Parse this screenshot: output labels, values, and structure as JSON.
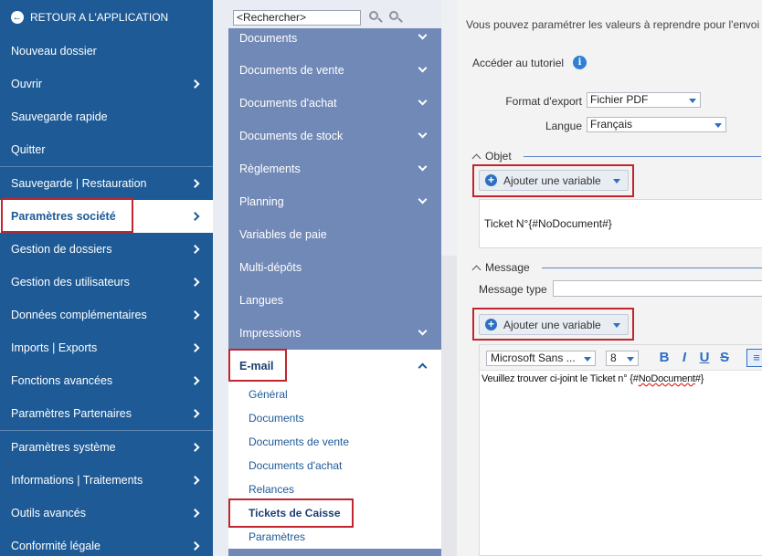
{
  "left_menu": {
    "back_label": "RETOUR A L'APPLICATION",
    "items": [
      {
        "label": "Nouveau dossier"
      },
      {
        "label": "Ouvrir"
      },
      {
        "label": "Sauvegarde rapide"
      },
      {
        "label": "Quitter"
      },
      {
        "label": "Sauvegarde | Restauration"
      },
      {
        "label": "Paramètres société"
      },
      {
        "label": "Gestion de dossiers"
      },
      {
        "label": "Gestion des utilisateurs"
      },
      {
        "label": "Données complémentaires"
      },
      {
        "label": "Imports | Exports"
      },
      {
        "label": "Fonctions avancées"
      },
      {
        "label": "Paramètres Partenaires"
      },
      {
        "label": "Paramètres système"
      },
      {
        "label": "Informations | Traitements"
      },
      {
        "label": "Outils avancés"
      },
      {
        "label": "Conformité légale"
      }
    ]
  },
  "middle": {
    "search_placeholder": "<Rechercher>",
    "categories": [
      {
        "label": "Documents"
      },
      {
        "label": "Documents de vente"
      },
      {
        "label": "Documents d'achat"
      },
      {
        "label": "Documents de stock"
      },
      {
        "label": "Règlements"
      },
      {
        "label": "Planning"
      },
      {
        "label": "Variables de paie"
      },
      {
        "label": "Multi-dépôts"
      },
      {
        "label": "Langues"
      },
      {
        "label": "Impressions"
      }
    ],
    "email_label": "E-mail",
    "email_sub": [
      {
        "label": "Général"
      },
      {
        "label": "Documents"
      },
      {
        "label": "Documents de vente"
      },
      {
        "label": "Documents d'achat"
      },
      {
        "label": "Relances"
      },
      {
        "label": "Tickets de Caisse"
      },
      {
        "label": "Paramètres"
      }
    ]
  },
  "right": {
    "intro": "Vous pouvez paramétrer les valeurs à reprendre pour l'envoi",
    "tutorial_label": "Accéder au tutoriel",
    "format_label": "Format d'export",
    "format_value": "Fichier PDF",
    "language_label": "Langue",
    "language_value": "Français",
    "objet_section": "Objet",
    "add_variable_label": "Ajouter une variable",
    "objet_text": "Ticket N°{#NoDocument#}",
    "message_section": "Message",
    "message_type_label": "Message type",
    "font_value": "Microsoft Sans ...",
    "font_size_value": "8",
    "message_text_prefix": "Veuillez trouver ci-joint le Ticket n° {#",
    "message_text_var": "NoDocument",
    "message_text_suffix": "#}"
  }
}
